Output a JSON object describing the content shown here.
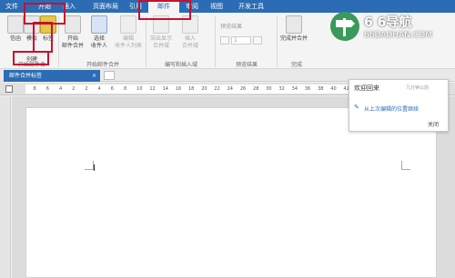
{
  "tabs": [
    {
      "label": "文件",
      "active": false
    },
    {
      "label": "开始",
      "active": false
    },
    {
      "label": "插入",
      "active": false
    },
    {
      "label": "页面布局",
      "active": false
    },
    {
      "label": "引用",
      "active": false
    },
    {
      "label": "邮件",
      "active": true
    },
    {
      "label": "审阅",
      "active": false
    },
    {
      "label": "视图",
      "active": false
    },
    {
      "label": "开发工具",
      "active": false
    }
  ],
  "ribbon": {
    "envelope": "信函",
    "template": "模板",
    "labels": "标签",
    "start_merge": "开始",
    "start_merge_2": "邮件合并",
    "select": "选择",
    "select_2": "收件人",
    "edit": "编辑",
    "edit_2": "收件人列表",
    "highlight": "突出显示",
    "highlight_2": "合并域",
    "insert": "插入",
    "insert_2": "合并域",
    "preview_results": "预览结果",
    "finish": "完成并合并",
    "group_create": "创建",
    "group_start": "开始邮件合并",
    "group_write": "编写和插入域",
    "group_preview": "预览结果",
    "group_finish": "完成",
    "record_value": "1"
  },
  "docbar": {
    "tab_label": "邮件合并标签"
  },
  "ruler_ticks": [
    "8",
    "6",
    "4",
    "2",
    "2",
    "4",
    "6",
    "8",
    "10",
    "12",
    "14",
    "16",
    "18",
    "20",
    "22",
    "24",
    "26",
    "28",
    "30",
    "32",
    "34",
    "36",
    "38",
    "40",
    "42",
    "44",
    "46",
    "48"
  ],
  "popup": {
    "title": "欢迎回来",
    "subtitle": "几分钟以前",
    "link": "从上次编辑的位置继续",
    "close": "关闭"
  },
  "watermark": {
    "title": "6 6导航",
    "url": "66DAOHAN.COM"
  },
  "colors": {
    "accent": "#2b6cb4",
    "highlight": "#c8102e",
    "watermark_green": "#3a9a5b"
  }
}
